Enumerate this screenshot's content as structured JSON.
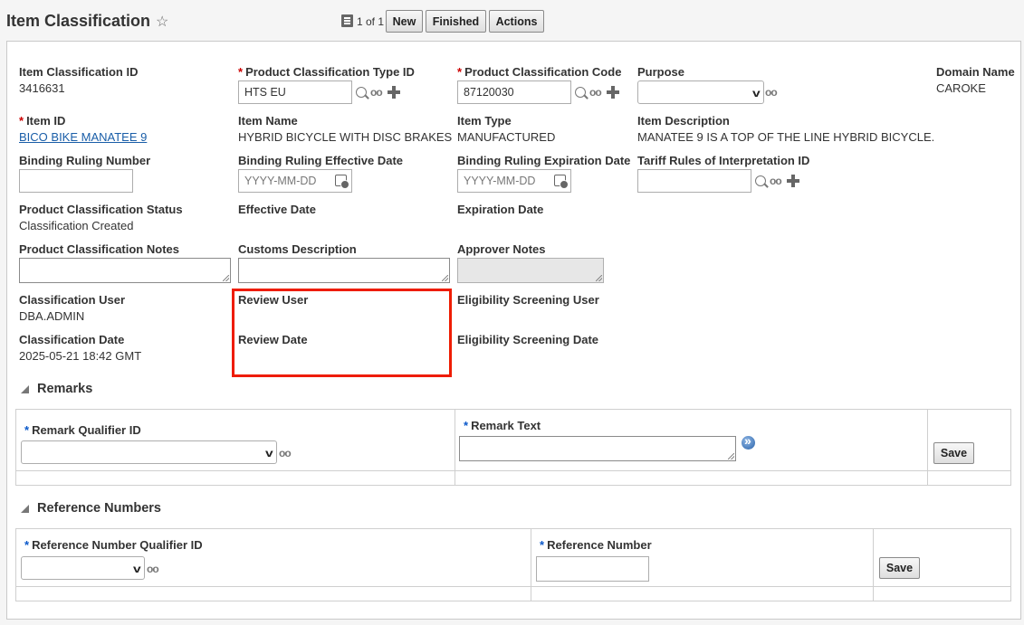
{
  "header": {
    "title": "Item Classification",
    "pager": "1 of 1",
    "buttons": {
      "new": "New",
      "finished": "Finished",
      "actions": "Actions"
    }
  },
  "form": {
    "item_classification_id": {
      "label": "Item Classification ID",
      "value": "3416631"
    },
    "product_classification_type_id": {
      "label": "Product Classification Type ID",
      "value": "HTS EU"
    },
    "product_classification_code": {
      "label": "Product Classification Code",
      "value": "87120030"
    },
    "purpose": {
      "label": "Purpose",
      "value": ""
    },
    "domain_name": {
      "label": "Domain Name",
      "value": "CAROKE"
    },
    "item_id": {
      "label": "Item ID",
      "value": "BICO BIKE MANATEE 9"
    },
    "item_name": {
      "label": "Item Name",
      "value": "HYBRID BICYCLE WITH DISC BRAKES"
    },
    "item_type": {
      "label": "Item Type",
      "value": "MANUFACTURED"
    },
    "item_description": {
      "label": "Item Description",
      "value": "MANATEE 9 IS A TOP OF THE LINE HYBRID BICYCLE."
    },
    "binding_ruling_number": {
      "label": "Binding Ruling Number",
      "value": ""
    },
    "binding_ruling_effective_date": {
      "label": "Binding Ruling Effective Date",
      "placeholder": "YYYY-MM-DD"
    },
    "binding_ruling_expiration_date": {
      "label": "Binding Ruling Expiration Date",
      "placeholder": "YYYY-MM-DD"
    },
    "tariff_rules_id": {
      "label": "Tariff Rules of Interpretation ID",
      "value": ""
    },
    "product_classification_status": {
      "label": "Product Classification Status",
      "value": "Classification Created"
    },
    "effective_date": {
      "label": "Effective Date"
    },
    "expiration_date": {
      "label": "Expiration Date"
    },
    "product_classification_notes": {
      "label": "Product Classification Notes"
    },
    "customs_description": {
      "label": "Customs Description"
    },
    "approver_notes": {
      "label": "Approver Notes"
    },
    "classification_user": {
      "label": "Classification User",
      "value": "DBA.ADMIN"
    },
    "review_user": {
      "label": "Review User"
    },
    "eligibility_screening_user": {
      "label": "Eligibility Screening User"
    },
    "classification_date": {
      "label": "Classification Date",
      "value": "2025-05-21 18:42 GMT"
    },
    "review_date": {
      "label": "Review Date"
    },
    "eligibility_screening_date": {
      "label": "Eligibility Screening Date"
    }
  },
  "remarks": {
    "title": "Remarks",
    "qualifier_label": "Remark Qualifier ID",
    "text_label": "Remark Text",
    "save": "Save"
  },
  "reference_numbers": {
    "title": "Reference Numbers",
    "qualifier_label": "Reference Number Qualifier ID",
    "number_label": "Reference Number",
    "save": "Save"
  },
  "colors": {
    "required": "#cc0000",
    "highlight": "#ee1c00",
    "link": "#1a5ea8"
  }
}
